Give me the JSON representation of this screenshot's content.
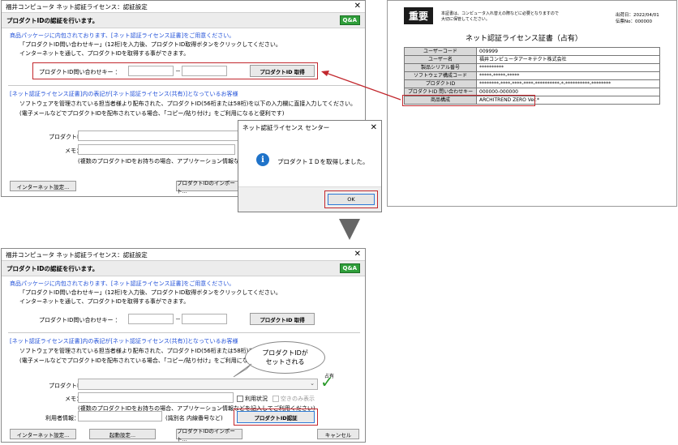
{
  "top_window": {
    "title": "福井コンピュータ ネット認証ライセンス：認証設定",
    "header": "プロダクトIDの認証を行います。",
    "qa_label": "Q&A",
    "section1_title": "商品パッケージに内包されております、[ネット認証ライセンス証書]をご用意ください。",
    "section1_line1": "「プロダクトID問い合わせキー」(12桁)を入力後、プロダクトID取得ボタンをクリックしてください。",
    "section1_line2": "インターネットを通して、プロダクトIDを取得する事ができます。",
    "inquiry_label": "プロダクトID問い合わせキー ：",
    "dash": "－",
    "get_button": "プロダクトID 取得",
    "section2_title": "[ネット認証ライセンス証書]内の表記が[ネット認証ライセンス(共有)]となっているお客様",
    "section2_line1": "ソフトウェアを管理されている担当者様より配布された、プロダクトID(56桁または58桁)を以下の入力欄に直接入力してください。",
    "section2_line2": "(電子メールなどでプロダクトIDを配布されている場合、「コピー/貼り付け」をご利用になると便利です)",
    "product_id_label": "プロダクトID：",
    "memo_label": "メモ：",
    "note": "(複数のプロダクトIDをお持ちの場合、アプリケーション情報などを記入",
    "internet_button": "インターネット設定...",
    "import_button": "プロダクトIDのインポート..."
  },
  "certificate": {
    "badge": "重要",
    "notice_line1": "本証書は、コンピュータ入れ替えの際などに必要となりますので",
    "notice_line2": "大切に保管してください。",
    "issue_date": "出荷日：2022/04/01",
    "issue_no": "伝票No：000000",
    "title": "ネット認証ライセンス証書（占有）",
    "rows": [
      {
        "label": "ユーザーコード",
        "value": "009999"
      },
      {
        "label": "ユーザー名",
        "value": "福井コンピュータアーキテクト株式会社"
      },
      {
        "label": "製品シリアル番号",
        "value": "**********"
      },
      {
        "label": "ソフトウェア構成コード",
        "value": "*****-*****-*****"
      },
      {
        "label": "プロダクトID",
        "value": "********-****-****-****-**********-*-**********-********"
      },
      {
        "label": "プロダクトID 問い合わせキー",
        "value": "000000-000000"
      },
      {
        "label": "商品構成",
        "value": "ARCHITREND ZERO Ver.*"
      }
    ]
  },
  "dialog": {
    "title": "ネット認証ライセンス センター",
    "message": "プロダクトＩＤを取得しました。",
    "ok_button": "OK",
    "info_glyph": "i"
  },
  "bottom_window": {
    "title": "福井コンピュータ ネット認証ライセンス：認証設定",
    "header": "プロダクトIDの認証を行います。",
    "qa_label": "Q&A",
    "section1_title": "商品パッケージに内包されております、[ネット認証ライセンス証書]をご用意ください。",
    "section1_line1": "「プロダクトID問い合わせキー」(12桁)を入力後、プロダクトID取得ボタンをクリックしてください。",
    "section1_line2": "インターネットを通して、プロダクトIDを取得する事ができます。",
    "inquiry_label": "プロダクトID問い合わせキー ：",
    "dash": "－",
    "get_button": "プロダクトID 取得",
    "section2_title": "[ネット認証ライセンス証書]内の表記が[ネット認証ライセンス(共有)]となっているお客様",
    "section2_line1": "ソフトウェアを管理されている担当者様より配布された、プロダクトID(56桁または58桁)を以下の入",
    "section2_line2": "(電子メールなどでプロダクトIDを配布されている場合、「コピー/貼り付け」をご利用になると便",
    "product_id_label": "プロダクトID：",
    "memo_label": "メモ：",
    "shared_label": "占有",
    "usage_status": "利用状況",
    "available_only": "空きのみ表示",
    "note": "(複数のプロダクトIDをお持ちの場合、アプリケーション情報などを記入してご利用ください)",
    "user_info_label": "利用者情報：",
    "user_info_hint": "(識別名 内線番号など)",
    "auth_button": "プロダクトID認証",
    "internet_button": "インターネット設定...",
    "launch_button": "起動設定...",
    "import_button": "プロダクトIDのインポート...",
    "cancel_button": "キャンセル"
  },
  "callout": {
    "line1": "プロダクトIDが",
    "line2": "セットされる"
  }
}
